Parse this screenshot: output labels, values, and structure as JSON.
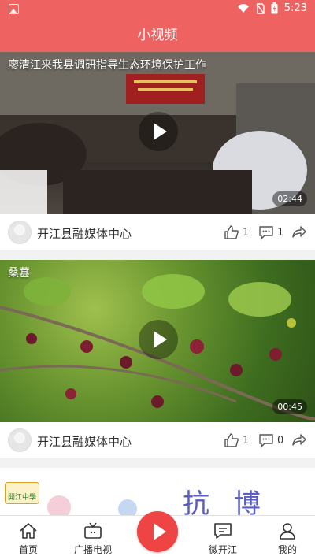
{
  "status": {
    "time": "5:23"
  },
  "app": {
    "title": "小视频"
  },
  "feed": [
    {
      "title": "廖清江来我县调研指导生态环境保护工作",
      "duration": "02:44",
      "author": "开江县融媒体中心",
      "likes": "1",
      "comments": "1"
    },
    {
      "title": "桑葚",
      "duration": "00:45",
      "author": "开江县融媒体中心",
      "likes": "1",
      "comments": "0"
    }
  ],
  "banner": {
    "text": "抗 博",
    "logo_text": "開江中學"
  },
  "tabs": [
    {
      "label": "首页",
      "icon": "home-icon"
    },
    {
      "label": "广播电视",
      "icon": "tv-icon"
    },
    {
      "label": "",
      "icon": "play-icon"
    },
    {
      "label": "微开江",
      "icon": "message-icon"
    },
    {
      "label": "我的",
      "icon": "user-icon"
    }
  ],
  "colors": {
    "accent": "#ef6262",
    "center": "#ef4444"
  }
}
